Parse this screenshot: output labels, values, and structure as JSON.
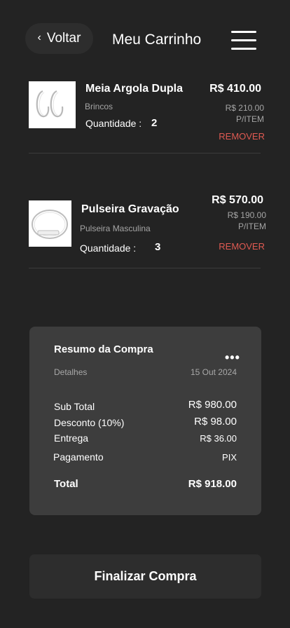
{
  "header": {
    "back_label": "Voltar",
    "title": "Meu Carrinho"
  },
  "items": [
    {
      "name": "Meia Argola Dupla",
      "category": "Brincos",
      "quantity_label": "Quantidade :",
      "quantity": "2",
      "total": "R$ 410.00",
      "unit_price": "R$ 210.00",
      "unit_suffix": "P/ITEM",
      "remove_label": "REMOVER"
    },
    {
      "name": "Pulseira Gravação",
      "category": "Pulseira Masculina",
      "quantity_label": "Quantidade :",
      "quantity": "3",
      "total": "R$ 570.00",
      "unit_price": "R$ 190.00",
      "unit_suffix": "P/ITEM",
      "remove_label": "REMOVER"
    }
  ],
  "summary": {
    "title": "Resumo da Compra",
    "details_label": "Detalhes",
    "date": "15 Out 2024",
    "subtotal_label": "Sub Total",
    "subtotal": "R$ 980.00",
    "discount_label": "Desconto (10%)",
    "discount": "R$ 98.00",
    "shipping_label": "Entrega",
    "shipping": "R$ 36.00",
    "payment_label": "Pagamento",
    "payment": "PIX",
    "total_label": "Total",
    "total": "R$ 918.00"
  },
  "checkout_label": "Finalizar Compra",
  "icons": {
    "back": "chevron-left-icon",
    "menu": "hamburger-menu-icon",
    "more": "more-dots-icon"
  },
  "colors": {
    "background": "#232323",
    "card": "#3d3d3d",
    "remove": "#e05a52"
  }
}
